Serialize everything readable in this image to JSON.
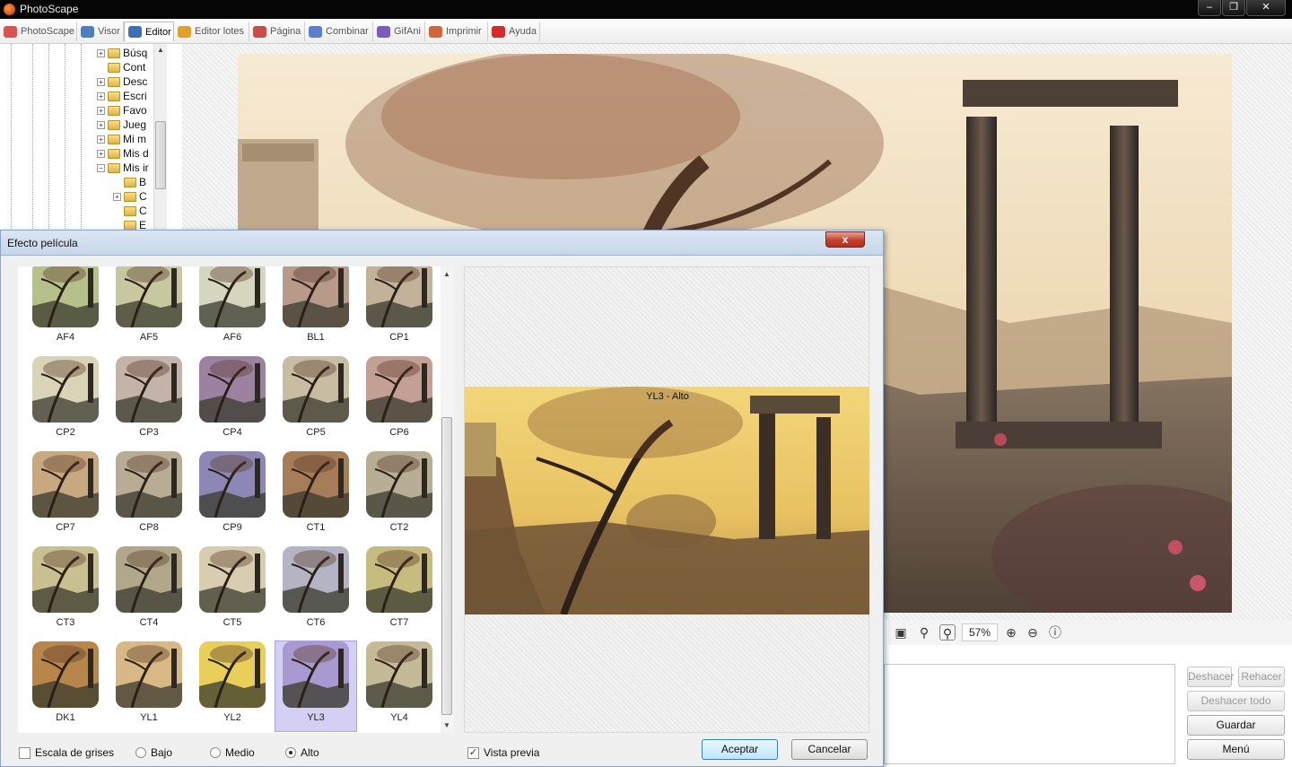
{
  "window": {
    "title": "PhotoScape",
    "controls": [
      "‒",
      "❐",
      "✕"
    ]
  },
  "tabs": [
    {
      "label": "PhotoScape",
      "icon": "photoscape-icon",
      "color": "#d9534f"
    },
    {
      "label": "Visor",
      "icon": "viewer-icon",
      "color": "#4a7fc1"
    },
    {
      "label": "Editor",
      "icon": "editor-icon",
      "color": "#3b6fb6",
      "active": true
    },
    {
      "label": "Editor lotes",
      "icon": "batch-editor-icon",
      "color": "#e0a02a"
    },
    {
      "label": "Página",
      "icon": "page-icon",
      "color": "#cc4b4b"
    },
    {
      "label": "Combinar",
      "icon": "combine-icon",
      "color": "#5a7fd0"
    },
    {
      "label": "GifAni",
      "icon": "gif-icon",
      "color": "#7a5bc0"
    },
    {
      "label": "Imprimir",
      "icon": "print-icon",
      "color": "#d0663a"
    },
    {
      "label": "Ayuda",
      "icon": "help-icon",
      "color": "#d42a2a"
    }
  ],
  "tree": {
    "items": [
      {
        "label": "Búsq",
        "pm": "+"
      },
      {
        "label": "Cont",
        "pm": ""
      },
      {
        "label": "Desc",
        "pm": "+"
      },
      {
        "label": "Escri",
        "pm": "+"
      },
      {
        "label": "Favo",
        "pm": "+"
      },
      {
        "label": "Jueg",
        "pm": "+"
      },
      {
        "label": "Mi m",
        "pm": "+"
      },
      {
        "label": "Mis d",
        "pm": "+"
      },
      {
        "label": "Mis ir",
        "pm": "−"
      },
      {
        "label": "B",
        "pm": ""
      },
      {
        "label": "C",
        "pm": "+"
      },
      {
        "label": "C",
        "pm": ""
      },
      {
        "label": "E",
        "pm": ""
      }
    ]
  },
  "zoom": {
    "value": "57%"
  },
  "side": {
    "undo": "Deshacer",
    "redo": "Rehacer",
    "undo_all": "Deshacer todo",
    "save": "Guardar",
    "menu": "Menú"
  },
  "dialog": {
    "title": "Efecto película",
    "close": "x",
    "filters": [
      {
        "label": "AF4",
        "tint": "#b6c08a"
      },
      {
        "label": "AF5",
        "tint": "#c7c7a0"
      },
      {
        "label": "AF6",
        "tint": "#d4d6c0"
      },
      {
        "label": "BL1",
        "tint": "#b89a8a"
      },
      {
        "label": "CP1",
        "tint": "#c2b29a"
      },
      {
        "label": "CP2",
        "tint": "#d9d4b8"
      },
      {
        "label": "CP3",
        "tint": "#c4b3a8"
      },
      {
        "label": "CP4",
        "tint": "#9c82a0"
      },
      {
        "label": "CP5",
        "tint": "#c8bca2"
      },
      {
        "label": "CP6",
        "tint": "#c39f94"
      },
      {
        "label": "CP7",
        "tint": "#c8a880"
      },
      {
        "label": "CP8",
        "tint": "#b9ac94"
      },
      {
        "label": "CP9",
        "tint": "#8c87b4"
      },
      {
        "label": "CT1",
        "tint": "#a77c58"
      },
      {
        "label": "CT2",
        "tint": "#b7ae95"
      },
      {
        "label": "CT3",
        "tint": "#c8c090"
      },
      {
        "label": "CT4",
        "tint": "#b1a88a"
      },
      {
        "label": "CT5",
        "tint": "#d8cdb0"
      },
      {
        "label": "CT6",
        "tint": "#b4b4c4"
      },
      {
        "label": "CT7",
        "tint": "#c7bc80"
      },
      {
        "label": "DK1",
        "tint": "#b8864a"
      },
      {
        "label": "YL1",
        "tint": "#d8b884"
      },
      {
        "label": "YL2",
        "tint": "#e8cf5a"
      },
      {
        "label": "YL3",
        "tint": "#a89ad0",
        "selected": true
      },
      {
        "label": "YL4",
        "tint": "#c4ba98"
      }
    ],
    "preview_caption": "YL3 - Alto",
    "grayscale_label": "Escala de grises",
    "grayscale_checked": false,
    "intensity": {
      "low": "Bajo",
      "medium": "Medio",
      "high": "Alto",
      "selected": "Alto"
    },
    "preview_label": "Vista previa",
    "preview_checked": true,
    "ok": "Aceptar",
    "cancel": "Cancelar"
  },
  "colors": {
    "titlebar": "#050505",
    "dialog_title": "#c6d6ea",
    "selection": "#d3d0f3",
    "close_button": "#c4402b"
  }
}
